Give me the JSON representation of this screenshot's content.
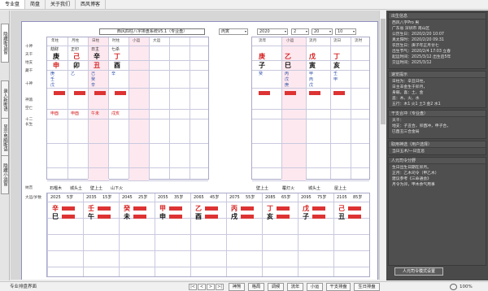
{
  "menu": {
    "items": [
      "专业盘",
      "简盘",
      "关于我们",
      "西风博客"
    ],
    "active_index": 0
  },
  "side_tabs": [
    {
      "label": "隐藏断语窗",
      "active": true
    },
    {
      "label": "录入新断语",
      "active": false
    },
    {
      "label": "显示电脑断语",
      "active": false
    },
    {
      "label": "隐藏小运窗",
      "active": false
    }
  ],
  "chart": {
    "title": "西风四柱八字排盘系统V5.1（专业盘）",
    "fields": [
      "丙寅",
      "2020",
      "2",
      "20",
      "10"
    ],
    "top_left_cols": [
      "年柱",
      "月柱",
      "日柱",
      "时柱",
      "小运",
      "大运"
    ],
    "top_right_cols": [
      "流年",
      "小运",
      "流月",
      "流日",
      "流时"
    ],
    "row_labels": [
      "十神",
      "天干",
      "地支",
      "藏干",
      "十神",
      "神煞",
      "空亡"
    ],
    "pillars": [
      {
        "shishen": "劫财",
        "gan": "庚",
        "zhi": "申",
        "cang": [
          "庚",
          "壬",
          "戊"
        ],
        "nayin": "石榴木"
      },
      {
        "shishen": "正印",
        "gan": "己",
        "zhi": "卯",
        "cang": [
          "乙"
        ],
        "nayin": "城头土"
      },
      {
        "shishen": "日主",
        "gan": "辛",
        "zhi": "丑",
        "cang": [
          "己",
          "癸",
          "辛"
        ],
        "nayin": "壁上土"
      },
      {
        "shishen": "七杀",
        "gan": "丁",
        "zhi": "酉",
        "cang": [
          "辛"
        ],
        "nayin": "山下火"
      }
    ],
    "flow": [
      {
        "gan": "庚",
        "zhi": "子",
        "cang": [
          "癸"
        ],
        "nayin": "壁上土"
      },
      {
        "gan": "乙",
        "zhi": "巳",
        "cang": [
          "丙",
          "戊",
          "庚"
        ],
        "nayin": "覆灯火"
      },
      {
        "gan": "戊",
        "zhi": "寅",
        "cang": [
          "甲",
          "丙",
          "戊"
        ],
        "nayin": "城头土"
      },
      {
        "gan": "丁",
        "zhi": "亥",
        "cang": [
          "壬",
          "甲"
        ],
        "nayin": "屋上土"
      }
    ],
    "kongwang": [
      "申酉",
      "申酉",
      "午未",
      "戌亥"
    ],
    "nayin_row_label": "纳音",
    "changsheng_labels": [
      "十二",
      "长生"
    ],
    "dayun_label": "大运/岁数",
    "dayun": [
      {
        "gan": "辛",
        "zhi": "巳",
        "year": "2025",
        "age": "5岁"
      },
      {
        "gan": "壬",
        "zhi": "午",
        "year": "2035",
        "age": "15岁"
      },
      {
        "gan": "癸",
        "zhi": "未",
        "year": "2045",
        "age": "25岁"
      },
      {
        "gan": "甲",
        "zhi": "申",
        "year": "2055",
        "age": "35岁"
      },
      {
        "gan": "乙",
        "zhi": "酉",
        "year": "2065",
        "age": "45岁"
      },
      {
        "gan": "丙",
        "zhi": "戌",
        "year": "2075",
        "age": "55岁"
      },
      {
        "gan": "丁",
        "zhi": "亥",
        "year": "2085",
        "age": "65岁"
      },
      {
        "gan": "戊",
        "zhi": "子",
        "year": "2095",
        "age": "75岁"
      },
      {
        "gan": "己",
        "zhi": "丑",
        "year": "2105",
        "age": "85岁"
      }
    ]
  },
  "right_panel": {
    "sections": [
      {
        "header": "出生信息",
        "lines": [
          "西风八字Pro      男",
          "广东省  深圳市  南山区",
          "公历生日：2020/2/20 10:07",
          "真太阳时：2020/2/20 09:31",
          "农历生日：庚子年正月廿七",
          "出生节气：2020/2/4 17:03 立春",
          "起运时间：2025/3/12 出生后5年",
          "交运时间：2025/3/12"
        ]
      },
      {
        "header": "速览提示",
        "lines": [
          "日柱为：辛丑日柱，",
          "日主辛金生于卯月，",
          "身弱，喜：土、金",
          "忌：木、火、水",
          "五行：木1 火1 土3 金2 水1"
        ]
      },
      {
        "header": "干支合冲（专业盘）",
        "lines": [
          "天干：",
          "地支：子丑合，卯酉冲，申子合，",
          "巳酉丑三合金局"
        ]
      },
      {
        "header": "取用神选（用户选择）",
        "lines": [
          "当日五术/一日宜忌"
        ]
      },
      {
        "header": "人元司令分野",
        "lines": [
          "生日出生日期在卯月。",
          "正月：乙木司令（甲乙木）",
          "建议参考《三命通会》",
          "月令为卯，甲木余气用事"
        ]
      }
    ],
    "button": "人元司令模式设置"
  },
  "statusbar": {
    "left": "专业排盘界面",
    "nav": [
      "|<",
      "<",
      ">",
      ">|"
    ],
    "buttons": [
      "神煞",
      "格局",
      "调候",
      "流年",
      "小运",
      "干支排盘",
      "生日排盘"
    ],
    "zoom": "100%"
  }
}
